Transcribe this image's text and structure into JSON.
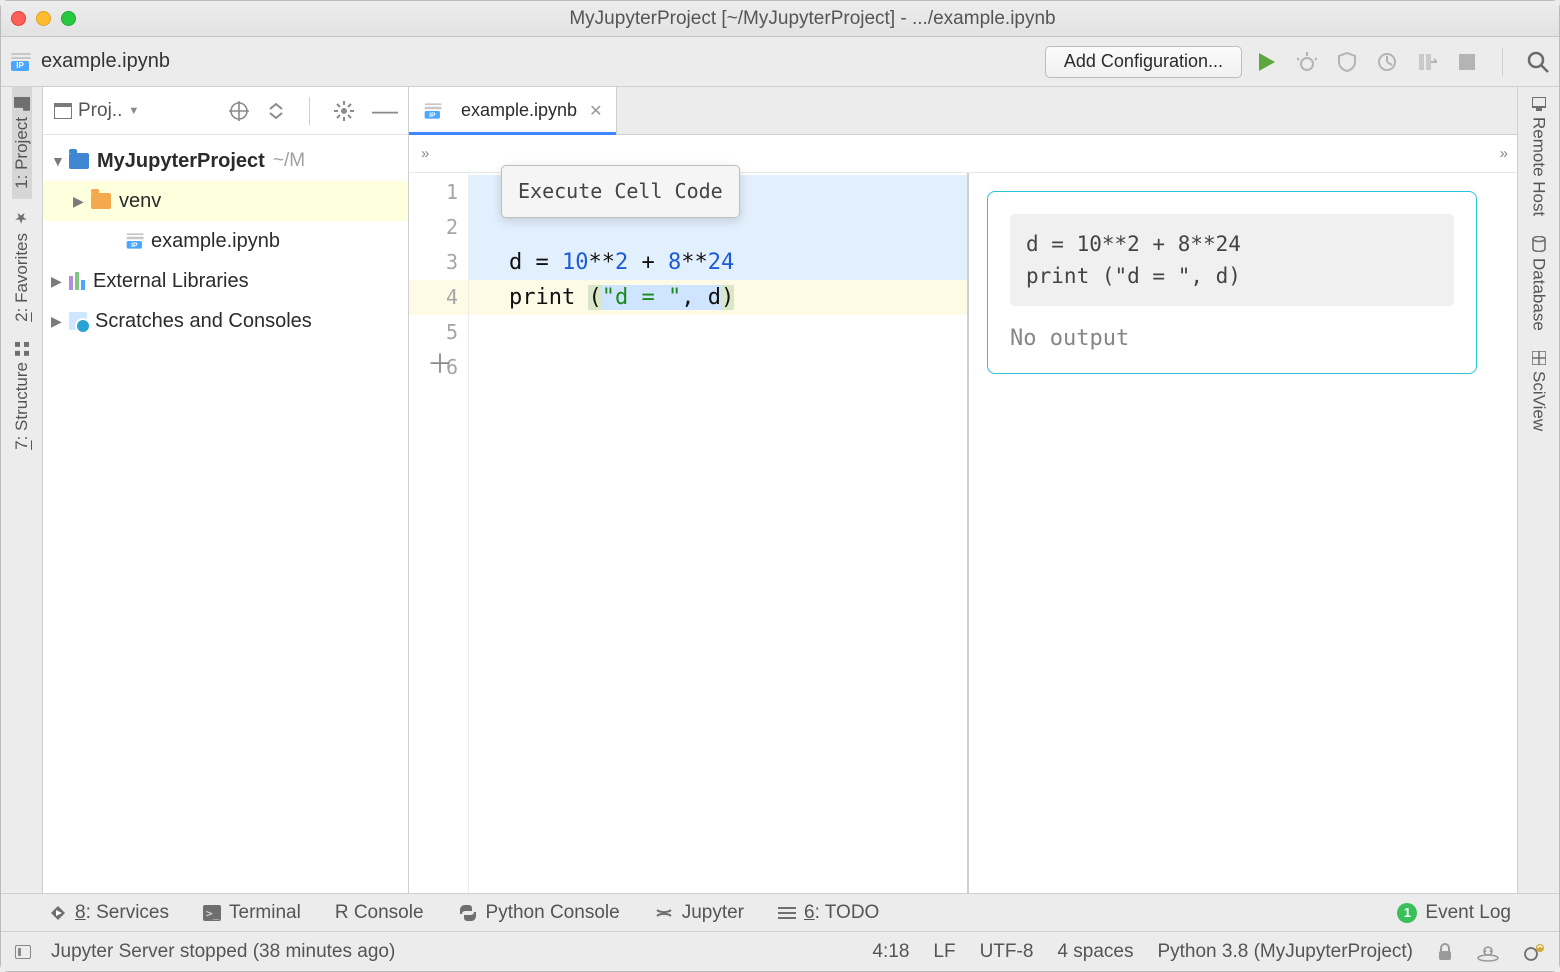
{
  "window": {
    "title": "MyJupyterProject [~/MyJupyterProject] - .../example.ipynb"
  },
  "top": {
    "open_file": "example.ipynb",
    "add_config": "Add Configuration..."
  },
  "project": {
    "label": "Proj..",
    "root": {
      "name": "MyJupyterProject",
      "path": "~/M"
    },
    "venv": "venv",
    "file": "example.ipynb",
    "ext": "External Libraries",
    "scratch": "Scratches and Consoles"
  },
  "tabs": {
    "t0": "example.ipynb"
  },
  "breadcrumbs": {
    "left": "»",
    "right": "»"
  },
  "gutter": {
    "l1": "1",
    "l2": "2",
    "l3": "3",
    "l4": "4",
    "l5": "5",
    "l6": "6"
  },
  "code": {
    "tooltip": "Execute Cell Code",
    "l3_a": "d = ",
    "l3_b": "10",
    "l3_c": "**",
    "l3_d": "2",
    "l3_e": " + ",
    "l3_f": "8",
    "l3_g": "**",
    "l3_h": "24",
    "l4_a": "print ",
    "l4_b": "(",
    "l4_c": "\"d = \"",
    "l4_d": ", d",
    "l4_e": ")"
  },
  "preview": {
    "src_line1": "d = 10**2 + 8**24",
    "src_line2": "print (\"d = \", d)",
    "output": "No output"
  },
  "left_strip": {
    "project": "1: Project",
    "favorites": "2: Favorites",
    "structure": "7: Structure"
  },
  "right_strip": {
    "remote": "Remote Host",
    "database": "Database",
    "sciview": "SciView"
  },
  "bottom": {
    "services": "8: Services",
    "terminal": "Terminal",
    "rconsole": "R Console",
    "pyconsole": "Python Console",
    "jupyter": "Jupyter",
    "todo": "6: TODO",
    "eventlog": "Event Log"
  },
  "status": {
    "message": "Jupyter Server stopped (38 minutes ago)",
    "pos": "4:18",
    "eol": "LF",
    "enc": "UTF-8",
    "indent": "4 spaces",
    "sdk": "Python 3.8 (MyJupyterProject)"
  }
}
